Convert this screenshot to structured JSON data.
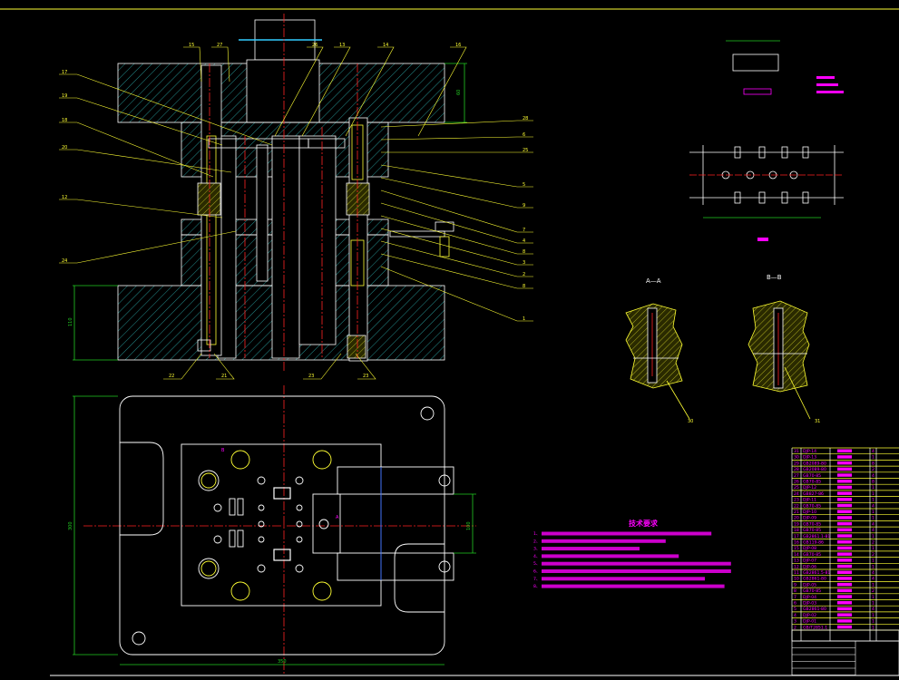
{
  "colors": {
    "background": "#000000",
    "outline": "#ffffff",
    "hatch": "#33cccc",
    "leader": "#ffff33",
    "center": "#ff2222",
    "dimension": "#22cc22",
    "text": "#ff00ff"
  },
  "elevation": {
    "left_labels": [
      "17",
      "19",
      "18",
      "20",
      "12",
      "24"
    ],
    "right_labels": [
      "28",
      "6",
      "25",
      "5",
      "9",
      "7",
      "4",
      "8",
      "3",
      "2",
      "8",
      "1"
    ],
    "top_labels": [
      "15",
      "27",
      "26",
      "13",
      "14",
      "16"
    ],
    "bottom_labels": [
      "22",
      "21",
      "23",
      "23"
    ],
    "dim_top": "60",
    "dim_bottom": "110"
  },
  "plan": {
    "dim_left": "300",
    "dim_bottom": "350",
    "dim_right": "100",
    "marker_a": "A",
    "marker_b": "B"
  },
  "sections": {
    "aa": "A—A",
    "bb": "B—B",
    "aa_tag": "30",
    "bb_tag": "31"
  },
  "tech": {
    "title": "技术要求",
    "items": [
      "1、",
      "2、",
      "3、",
      "4、",
      "5、",
      "6、",
      "7、",
      "8、"
    ]
  },
  "bom": {
    "rows": [
      {
        "no": "31",
        "code": "DJP-14",
        "qty": "4"
      },
      {
        "no": "30",
        "code": "DJP-13",
        "qty": "1"
      },
      {
        "no": "29",
        "code": "GB2089-80",
        "qty": "8"
      },
      {
        "no": "28",
        "code": "GB2089-80",
        "qty": "2"
      },
      {
        "no": "27",
        "code": "GB70-85",
        "qty": "4"
      },
      {
        "no": "26",
        "code": "GB70-85",
        "qty": "8"
      },
      {
        "no": "25",
        "code": "DJP-12",
        "qty": "1"
      },
      {
        "no": "24",
        "code": "GB827-86",
        "qty": "1"
      },
      {
        "no": "23",
        "code": "DJP-11",
        "qty": "1"
      },
      {
        "no": "22",
        "code": "GB70-85",
        "qty": "4"
      },
      {
        "no": "21",
        "code": "DJP-10",
        "qty": "1"
      },
      {
        "no": "20",
        "code": "DJP-09",
        "qty": "1"
      },
      {
        "no": "19",
        "code": "GB70-85",
        "qty": "4"
      },
      {
        "no": "18",
        "code": "GB70-85",
        "qty": "4"
      },
      {
        "no": "17",
        "code": "GB2861.1-81",
        "qty": "1"
      },
      {
        "no": "16",
        "code": "GB119-86",
        "qty": "2"
      },
      {
        "no": "15",
        "code": "DJP-08",
        "qty": "1"
      },
      {
        "no": "14",
        "code": "GB70-85",
        "qty": "2"
      },
      {
        "no": "13",
        "code": "DJP-07",
        "qty": "1"
      },
      {
        "no": "12",
        "code": "DJP-06",
        "qty": "1"
      },
      {
        "no": "11",
        "code": "GB2861.5-81",
        "qty": "4"
      },
      {
        "no": "10",
        "code": "GB2861-80",
        "qty": "4"
      },
      {
        "no": "9",
        "code": "DJP-05",
        "qty": "1"
      },
      {
        "no": "8",
        "code": "GB70-85",
        "qty": "2"
      },
      {
        "no": "7",
        "code": "DJP-04",
        "qty": "1"
      },
      {
        "no": "6",
        "code": "DJP-03",
        "qty": "1"
      },
      {
        "no": "5",
        "code": "GB2861-80",
        "qty": "4"
      },
      {
        "no": "4",
        "code": "DJP-02",
        "qty": "1"
      },
      {
        "no": "3",
        "code": "DJP-01",
        "qty": "1"
      },
      {
        "no": "2",
        "code": "GB/T2851.1",
        "qty": "1"
      }
    ]
  }
}
